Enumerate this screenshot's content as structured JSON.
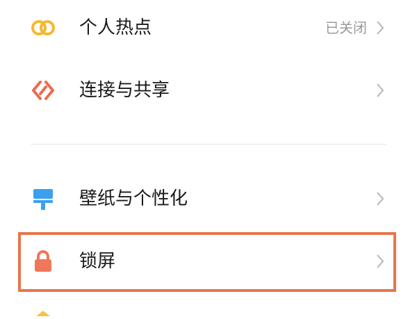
{
  "settings": {
    "items": [
      {
        "label": "个人热点",
        "status": "已关闭",
        "icon": "hotspot-icon"
      },
      {
        "label": "连接与共享",
        "status": "",
        "icon": "connection-sharing-icon"
      },
      {
        "label": "壁纸与个性化",
        "status": "",
        "icon": "wallpaper-icon"
      },
      {
        "label": "锁屏",
        "status": "",
        "icon": "lock-icon"
      }
    ]
  },
  "colors": {
    "hotspot": "#f5b82e",
    "connection": "#ef6a4c",
    "wallpaper": "#3aa0ee",
    "lock": "#f0775a",
    "highlight_border": "#e8764a",
    "partial_icon": "#f5c542"
  }
}
